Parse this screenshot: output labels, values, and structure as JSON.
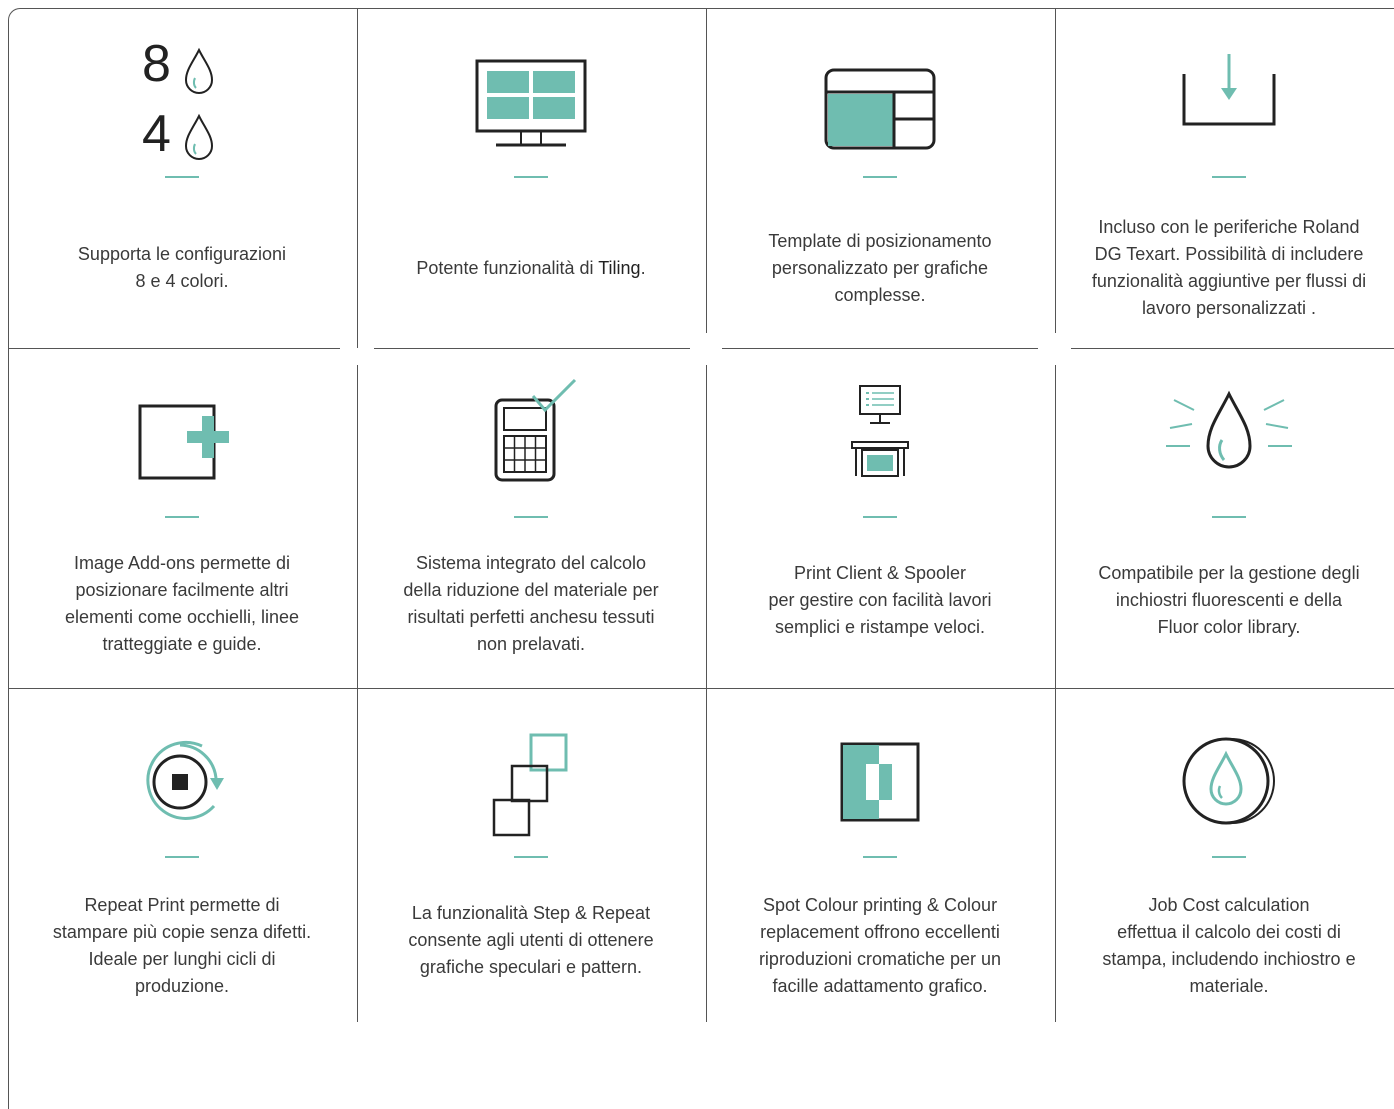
{
  "colors": {
    "accent": "#6fbdb0",
    "line": "#222222",
    "text": "#3a3a3a"
  },
  "features": [
    {
      "icon": "ink-configuration-icon",
      "num_top": "8",
      "num_bottom": "4",
      "text": "Supporta le configurazioni\n8 e 4 colori."
    },
    {
      "icon": "tiling-monitor-icon",
      "text_pre": "Potente funzionalità di ",
      "text_link": "Tiling",
      "text_post": "."
    },
    {
      "icon": "template-layout-icon",
      "text": "Template di posizionamento\npersonalizzato per grafiche\ncomplesse."
    },
    {
      "icon": "download-tray-icon",
      "text": "Incluso con le periferiche Roland\nDG Texart. Possibilità di includere\nfunzionalità aggiuntive per flussi di\nlavoro personalizzati ."
    },
    {
      "icon": "image-add-on-icon",
      "text": "Image Add-ons permette di\nposizionare facilmente altri\nelementi come occhielli, linee\ntratteggiate e guide."
    },
    {
      "icon": "calculator-check-icon",
      "text": "Sistema integrato del calcolo\ndella riduzione del materiale per\nrisultati perfetti anchesu tessuti\nnon prelavati."
    },
    {
      "icon": "print-client-spooler-icon",
      "text": "Print Client & Spooler\nper gestire con facilità lavori\nsemplici e ristampe veloci."
    },
    {
      "icon": "fluorescent-ink-icon",
      "text": "Compatibile per la gestione degli\ninchiostri fluorescenti e della\nFluor color library."
    },
    {
      "icon": "repeat-print-icon",
      "text": "Repeat Print permette di\nstampare più copie senza difetti.\nIdeale per lunghi cicli di\nproduzione."
    },
    {
      "icon": "step-repeat-icon",
      "text": "La funzionalità Step & Repeat\nconsente agli utenti di ottenere\ngrafiche speculari e pattern."
    },
    {
      "icon": "spot-colour-icon",
      "text": "Spot Colour printing & Colour\nreplacement offrono eccellenti\nriproduzioni cromatiche per un\nfacille adattamento grafico."
    },
    {
      "icon": "job-cost-icon",
      "text": "Job Cost calculation\neffettua il calcolo dei costi di\nstampa, includendo inchiostro e\nmateriale."
    }
  ]
}
